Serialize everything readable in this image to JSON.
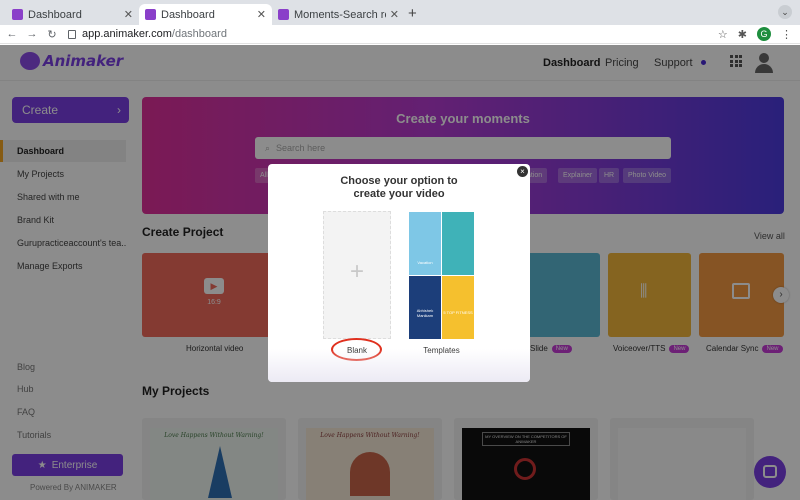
{
  "browser": {
    "tabs": [
      {
        "title": "Dashboard",
        "active": false
      },
      {
        "title": "Dashboard",
        "active": true
      },
      {
        "title": "Moments-Search results",
        "active": false
      }
    ],
    "url_host": "app.animaker.com",
    "url_path": "/dashboard",
    "profile_initial": "G"
  },
  "header": {
    "logo_text": "Animaker",
    "nav": [
      "Dashboard",
      "Pricing",
      "Support"
    ]
  },
  "sidebar": {
    "create_label": "Create",
    "items": [
      "Dashboard",
      "My Projects",
      "Shared with me",
      "Brand Kit",
      "Gurupracticeaccount's tea...",
      "Manage Exports"
    ],
    "secondary": [
      "Blog",
      "Hub",
      "FAQ",
      "Tutorials"
    ],
    "enterprise_label": "Enterprise",
    "powered_by": "Powered By ANIMAKER"
  },
  "banner": {
    "title": "Create your moments",
    "search_placeholder": "Search here",
    "chips": [
      "All",
      "ation",
      "Explainer",
      "HR",
      "Photo Video"
    ]
  },
  "create_project": {
    "title": "Create Project",
    "view_all": "View all",
    "cards": [
      {
        "label": "Horizontal video",
        "badge": "",
        "color": "#f06a5c",
        "sublabel": "16:9"
      },
      {
        "label": "Slide",
        "badge": "New",
        "color": "#5bb8d4",
        "sublabel": ""
      },
      {
        "label": "Voiceover/TTS",
        "badge": "New",
        "color": "#f2b63b",
        "sublabel": ""
      },
      {
        "label": "Calendar Sync",
        "badge": "New",
        "color": "#f49a43",
        "sublabel": ""
      }
    ]
  },
  "my_projects": {
    "title": "My Projects",
    "thumbs": [
      "Love Happens Without Warning!",
      "Love Happens Without Warning!",
      "MY OVERVIEW ON THE COMPETITORS OF ANIMAKER",
      ""
    ]
  },
  "modal": {
    "title_line1": "Choose your option to",
    "title_line2": "create your video",
    "options": [
      {
        "label": "Blank"
      },
      {
        "label": "Templates"
      }
    ],
    "template_texts": [
      "Vacation",
      "Abhishek Manikam",
      "5 TOP FITNESS"
    ],
    "close_glyph": "×"
  },
  "colors": {
    "accent": "#7b3fe4",
    "highlight_ring": "#e0301e"
  }
}
